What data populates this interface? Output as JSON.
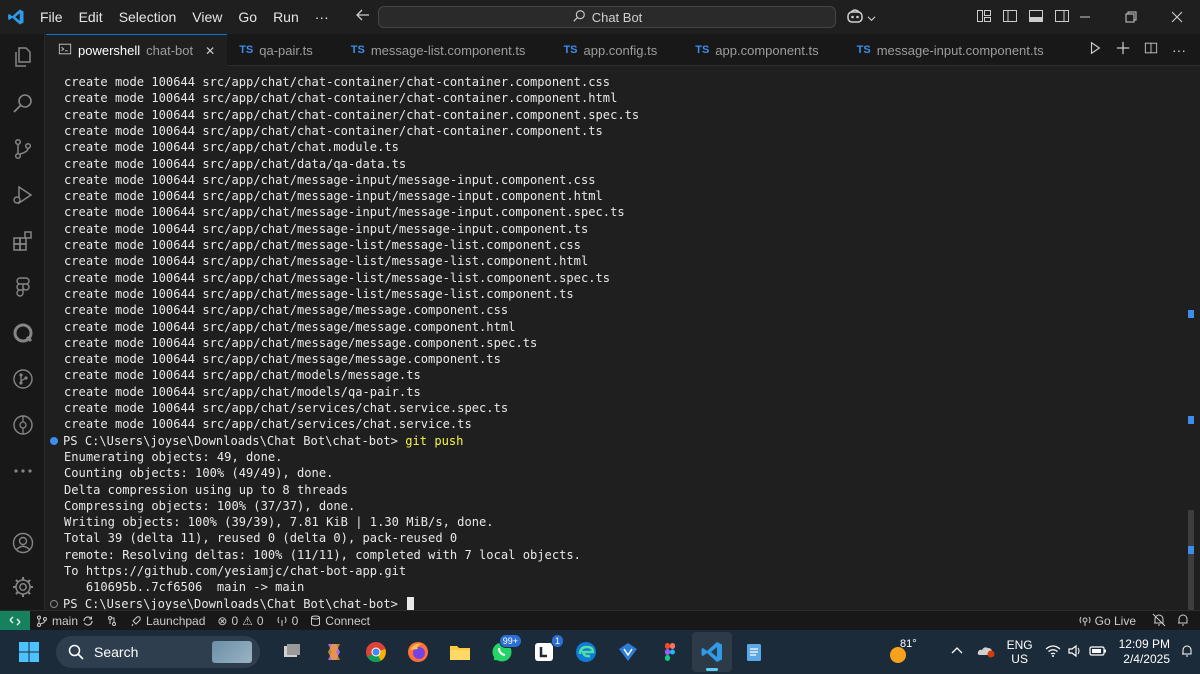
{
  "menu": [
    "File",
    "Edit",
    "Selection",
    "View",
    "Go",
    "Run",
    "···"
  ],
  "search": {
    "label": "Chat Bot"
  },
  "tabs": [
    {
      "kind": "terminal",
      "label": "powershell",
      "sub": "chat-bot",
      "active": true
    },
    {
      "kind": "ts",
      "label": "qa-pair.ts"
    },
    {
      "kind": "ts",
      "label": "message-list.component.ts"
    },
    {
      "kind": "ts",
      "label": "app.config.ts"
    },
    {
      "kind": "ts",
      "label": "app.component.ts"
    },
    {
      "kind": "ts",
      "label": "message-input.component.ts"
    }
  ],
  "tab_ts_badge": "TS",
  "terminal": {
    "lines": [
      "create mode 100644 src/app/chat/chat-container/chat-container.component.css",
      "create mode 100644 src/app/chat/chat-container/chat-container.component.html",
      "create mode 100644 src/app/chat/chat-container/chat-container.component.spec.ts",
      "create mode 100644 src/app/chat/chat-container/chat-container.component.ts",
      "create mode 100644 src/app/chat/chat.module.ts",
      "create mode 100644 src/app/chat/data/qa-data.ts",
      "create mode 100644 src/app/chat/message-input/message-input.component.css",
      "create mode 100644 src/app/chat/message-input/message-input.component.html",
      "create mode 100644 src/app/chat/message-input/message-input.component.spec.ts",
      "create mode 100644 src/app/chat/message-input/message-input.component.ts",
      "create mode 100644 src/app/chat/message-list/message-list.component.css",
      "create mode 100644 src/app/chat/message-list/message-list.component.html",
      "create mode 100644 src/app/chat/message-list/message-list.component.spec.ts",
      "create mode 100644 src/app/chat/message-list/message-list.component.ts",
      "create mode 100644 src/app/chat/message/message.component.css",
      "create mode 100644 src/app/chat/message/message.component.html",
      "create mode 100644 src/app/chat/message/message.component.spec.ts",
      "create mode 100644 src/app/chat/message/message.component.ts",
      "create mode 100644 src/app/chat/models/message.ts",
      "create mode 100644 src/app/chat/models/qa-pair.ts",
      "create mode 100644 src/app/chat/services/chat.service.spec.ts",
      "create mode 100644 src/app/chat/services/chat.service.ts"
    ],
    "prompt1": "PS C:\\Users\\joyse\\Downloads\\Chat Bot\\chat-bot>",
    "command1": "git push",
    "output": [
      "Enumerating objects: 49, done.",
      "Counting objects: 100% (49/49), done.",
      "Delta compression using up to 8 threads",
      "Compressing objects: 100% (37/37), done.",
      "Writing objects: 100% (39/39), 7.81 KiB | 1.30 MiB/s, done.",
      "Total 39 (delta 11), reused 0 (delta 0), pack-reused 0",
      "remote: Resolving deltas: 100% (11/11), completed with 7 local objects.",
      "To https://github.com/yesiamjc/chat-bot-app.git",
      "   610695b..7cf6506  main -> main"
    ],
    "prompt2": "PS C:\\Users\\joyse\\Downloads\\Chat Bot\\chat-bot>"
  },
  "statusbar": {
    "branch": "main",
    "launchpad": "Launchpad",
    "errors": "0",
    "warnings": "0",
    "ports": "0",
    "connect": "Connect",
    "golive": "Go Live"
  },
  "taskbar": {
    "search_label": "Search",
    "badges": {
      "whatsapp": "99+",
      "l_app": "1"
    },
    "weather_temp": "81°",
    "lang1": "ENG",
    "lang2": "US",
    "time": "12:09 PM",
    "date": "2/4/2025"
  },
  "colors": {
    "accent": "#0078d4",
    "ts_blue": "#3b8eea",
    "command_yellow": "#f5f543",
    "remote_green": "#16825d",
    "taskbar": "#1c2b3a"
  }
}
